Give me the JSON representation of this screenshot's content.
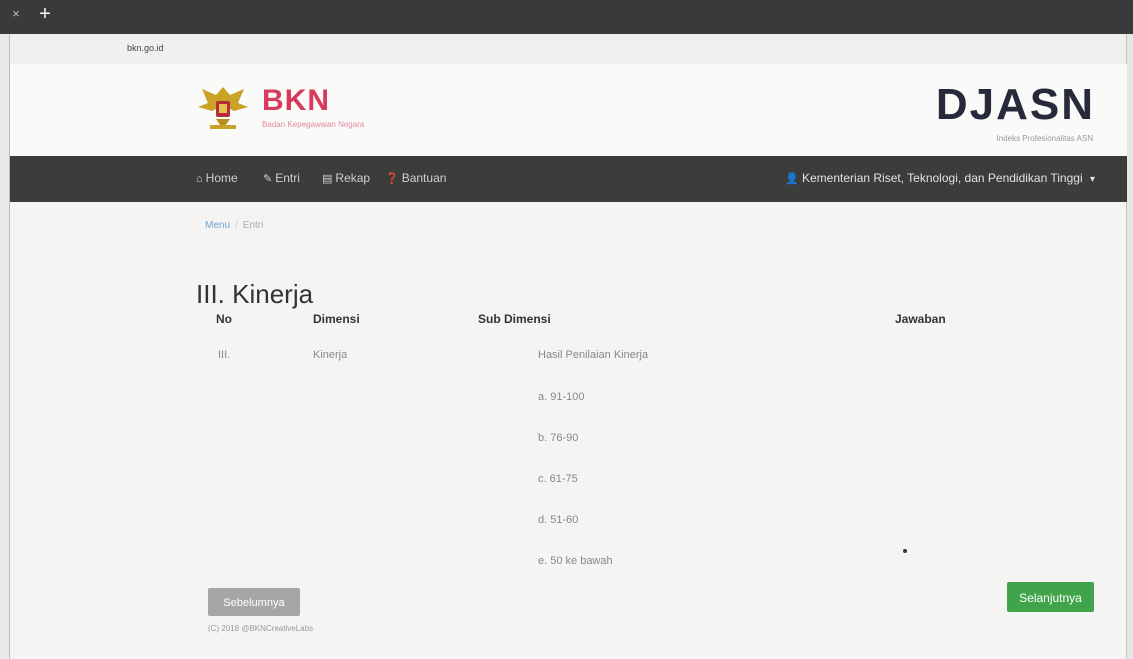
{
  "browser": {
    "close_glyph": "×",
    "new_tab_glyph": "+",
    "address": "bkn.go.id"
  },
  "header": {
    "logo_title": "BKN",
    "logo_subtitle": "Badan Kepegawaian Negara",
    "brand": "DJASN",
    "brand_subtitle": "Indeks Profesionalitas ASN"
  },
  "nav": {
    "items": [
      {
        "label": "Home",
        "icon": "home-icon"
      },
      {
        "label": "Entri",
        "icon": "pencil-icon"
      },
      {
        "label": "Rekap",
        "icon": "book-icon"
      },
      {
        "label": "Bantuan",
        "icon": "question-icon"
      }
    ],
    "user_label": "Kementerian Riset, Teknologi, dan Pendidikan Tinggi",
    "user_caret": "▾"
  },
  "breadcrumb": {
    "link": "Menu",
    "separator": "/",
    "current": "Entri"
  },
  "page_title": "III. Kinerja",
  "table": {
    "headers": {
      "no": "No",
      "dimensi": "Dimensi",
      "sub_dimensi": "Sub Dimensi",
      "jawaban": "Jawaban"
    },
    "row": {
      "no": "III.",
      "dimensi": "Kinerja",
      "sub_dimensi": "Hasil Penilaian Kinerja",
      "options": [
        "a. 91-100",
        "b. 76-90",
        "c. 61-75",
        "d. 51-60",
        "e. 50 ke bawah"
      ]
    }
  },
  "buttons": {
    "prev": "Sebelumnya",
    "next": "Selanjutnya"
  },
  "footer": "(C) 2018 @BKNCreativeLabs",
  "colors": {
    "brand_red": "#d83a5e",
    "navbar": "#3b3d3b",
    "next_green": "#3fa44a",
    "prev_gray": "#a6a6a8"
  }
}
